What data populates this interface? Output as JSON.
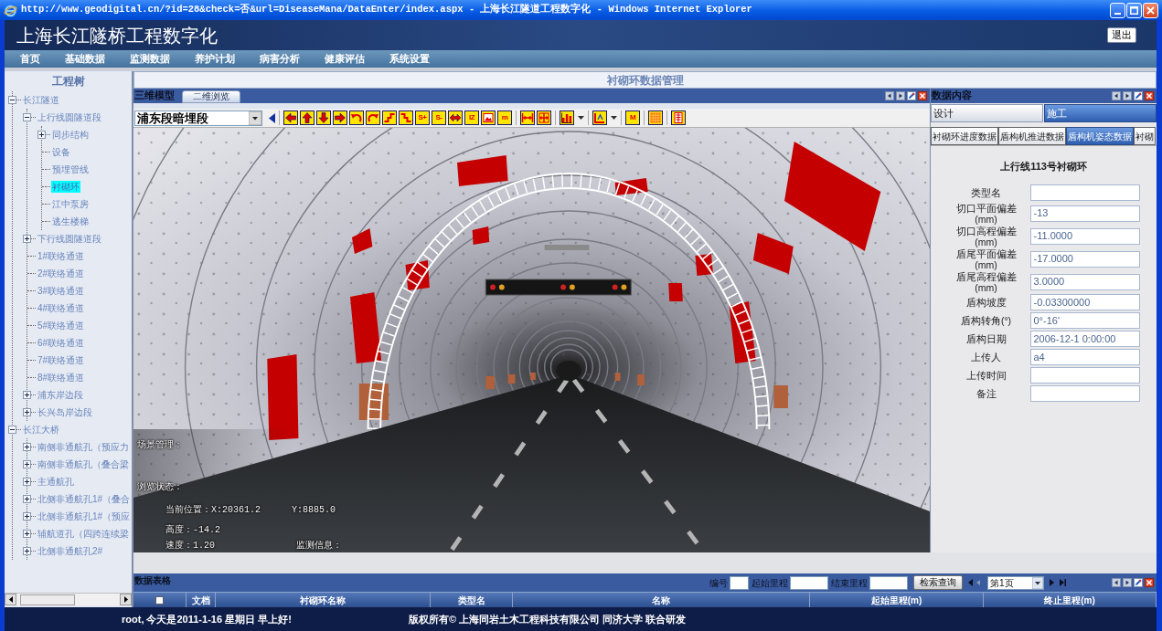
{
  "window": {
    "title": "http://www.geodigital.cn/?id=28&check=否&url=DiseaseMana/DataEnter/index.aspx - 上海长江隧道工程数字化 - Windows Internet Explorer"
  },
  "header": {
    "title": "上海长江隧桥工程数字化",
    "logout": "退出"
  },
  "menu": [
    {
      "label": "首页"
    },
    {
      "label": "基础数据"
    },
    {
      "label": "监测数据"
    },
    {
      "label": "养护计划"
    },
    {
      "label": "病害分析"
    },
    {
      "label": "健康评估"
    },
    {
      "label": "系统设置"
    }
  ],
  "sidebar": {
    "title": "工程树",
    "tree": [
      {
        "label": "长江隧道",
        "expanded": true,
        "selected": false,
        "children": [
          {
            "label": "上行线圆隧道段",
            "expanded": true,
            "selected": false,
            "children": [
              {
                "label": "同步结构",
                "expanded": false,
                "selected": false
              },
              {
                "label": "设备",
                "selected": false
              },
              {
                "label": "预埋管线",
                "selected": false
              },
              {
                "label": "衬砌环",
                "selected": true
              },
              {
                "label": "江中泵房",
                "selected": false
              },
              {
                "label": "逃生楼梯",
                "selected": false
              }
            ]
          },
          {
            "label": "下行线圆隧道段",
            "expanded": false,
            "selected": false
          },
          {
            "label": "1#联络通道",
            "selected": false
          },
          {
            "label": "2#联络通道",
            "selected": false
          },
          {
            "label": "3#联络通道",
            "selected": false
          },
          {
            "label": "4#联络通道",
            "selected": false
          },
          {
            "label": "5#联络通道",
            "selected": false
          },
          {
            "label": "6#联络通道",
            "selected": false
          },
          {
            "label": "7#联络通道",
            "selected": false
          },
          {
            "label": "8#联络通道",
            "selected": false
          },
          {
            "label": "浦东岸边段",
            "expanded": false,
            "selected": false
          },
          {
            "label": "长兴岛岸边段",
            "expanded": false,
            "selected": false
          }
        ]
      },
      {
        "label": "长江大桥",
        "expanded": true,
        "selected": false,
        "children": [
          {
            "label": "南侧非通航孔（预应力",
            "expanded": false,
            "selected": false
          },
          {
            "label": "南侧非通航孔（叠合梁",
            "expanded": false,
            "selected": false
          },
          {
            "label": "主通航孔",
            "expanded": false,
            "selected": false
          },
          {
            "label": "北侧非通航孔1#（叠合",
            "expanded": false,
            "selected": false
          },
          {
            "label": "北侧非通航孔1#（预应",
            "expanded": false,
            "selected": false
          },
          {
            "label": "辅航道孔（四跨连续梁",
            "expanded": false,
            "selected": false
          },
          {
            "label": "北侧非通航孔2#",
            "expanded": false,
            "selected": false
          }
        ]
      }
    ]
  },
  "page_title": "衬砌环数据管理",
  "model_panel": {
    "title": "三维模型",
    "view_tab": "二维浏览",
    "section": "浦东段暗埋段",
    "tool_groups": [
      [
        {
          "kind": "left"
        },
        {
          "kind": "up"
        },
        {
          "kind": "down"
        },
        {
          "kind": "right"
        },
        {
          "kind": "undo"
        },
        {
          "kind": "redo"
        },
        {
          "kind": "rise"
        },
        {
          "kind": "fall"
        },
        {
          "kind": "text",
          "glyph": "S+"
        },
        {
          "kind": "text",
          "glyph": "S-"
        },
        {
          "kind": "swap"
        },
        {
          "kind": "text",
          "glyph": "IZ"
        },
        {
          "kind": "image"
        },
        {
          "kind": "text",
          "glyph": "m"
        }
      ],
      [
        {
          "kind": "shrink"
        },
        {
          "kind": "expand"
        }
      ],
      [
        {
          "kind": "chart",
          "menu": true
        }
      ],
      [
        {
          "kind": "ruler",
          "menu": true
        }
      ],
      [
        {
          "kind": "text",
          "glyph": "M"
        }
      ],
      [
        {
          "kind": "grid"
        }
      ],
      [
        {
          "kind": "page"
        }
      ]
    ],
    "overlay": {
      "scene": "场景管理：",
      "status": "浏览状态：",
      "position_x": "当前位置：X:20361.2",
      "position_y": "Y:8885.0",
      "height": "高度：-14.2",
      "speed": "速度：1.20",
      "monitor": "监测信息："
    }
  },
  "data_panel": {
    "title": "数据内容",
    "tabs": [
      {
        "label": "设计",
        "selected": false
      },
      {
        "label": "施工",
        "selected": true
      }
    ],
    "subtabs": [
      {
        "label": "衬砌环进度数据",
        "selected": false
      },
      {
        "label": "盾构机推进数据",
        "selected": false
      },
      {
        "label": "盾构机姿态数据",
        "selected": true
      },
      {
        "label": "衬砌",
        "selected": false
      }
    ],
    "form": {
      "title": "上行线113号衬砌环",
      "fields": [
        {
          "label": "类型名"
        },
        {
          "label": "切口平面偏差(mm)",
          "value": "-13"
        },
        {
          "label": "切口高程偏差(mm)",
          "value": "-11.0000"
        },
        {
          "label": "盾尾平面偏差(mm)",
          "value": "-17.0000"
        },
        {
          "label": "盾尾高程偏差(mm)",
          "value": "3.0000"
        },
        {
          "label": "盾构坡度",
          "value": "-0.03300000"
        },
        {
          "label": "盾构转角(°)",
          "value": "0°-16'"
        },
        {
          "label": "盾构日期",
          "value": "2006-12-1 0:00:00"
        },
        {
          "label": "上传人",
          "value": "a4"
        },
        {
          "label": "上传时间"
        },
        {
          "label": "备注"
        }
      ]
    }
  },
  "table_panel": {
    "title": "数据表格",
    "search": [
      {
        "label": "编号"
      },
      {
        "label": "起始里程"
      },
      {
        "label": "结束里程"
      }
    ],
    "search_button": "检索查询",
    "page": "第1页",
    "select_all": {
      "checked": false
    },
    "columns": [
      "文档",
      "衬砌环名称",
      "类型名",
      "名称",
      "起始里程(m)",
      "终止里程(m)"
    ]
  },
  "status_bar": {
    "greeting": "root, 今天是2011-1-16 星期日 早上好!",
    "copyright": "版权所有© 上海同岩土木工程科技有限公司 同济大学 联合研发"
  }
}
